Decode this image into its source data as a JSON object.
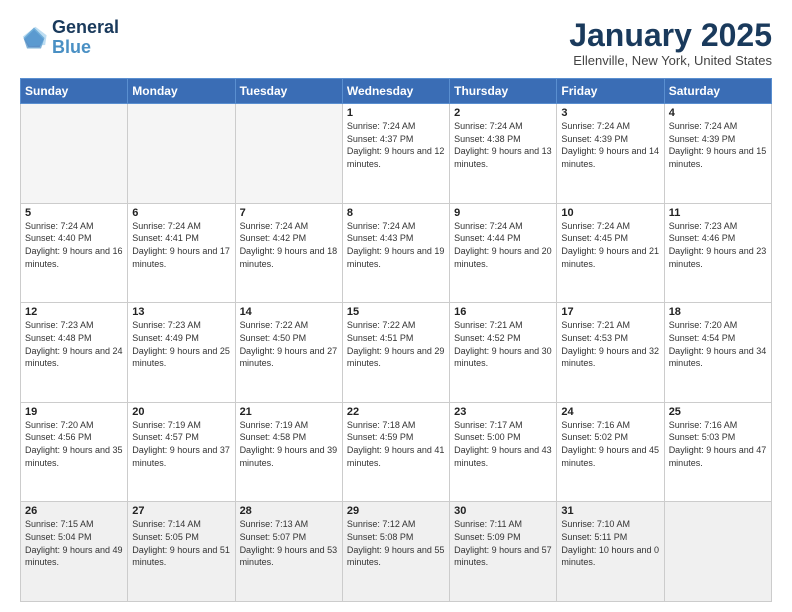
{
  "header": {
    "logo_line1": "General",
    "logo_line2": "Blue",
    "month": "January 2025",
    "location": "Ellenville, New York, United States"
  },
  "weekdays": [
    "Sunday",
    "Monday",
    "Tuesday",
    "Wednesday",
    "Thursday",
    "Friday",
    "Saturday"
  ],
  "weeks": [
    [
      {
        "day": "",
        "info": ""
      },
      {
        "day": "",
        "info": ""
      },
      {
        "day": "",
        "info": ""
      },
      {
        "day": "1",
        "info": "Sunrise: 7:24 AM\nSunset: 4:37 PM\nDaylight: 9 hours and 12 minutes."
      },
      {
        "day": "2",
        "info": "Sunrise: 7:24 AM\nSunset: 4:38 PM\nDaylight: 9 hours and 13 minutes."
      },
      {
        "day": "3",
        "info": "Sunrise: 7:24 AM\nSunset: 4:39 PM\nDaylight: 9 hours and 14 minutes."
      },
      {
        "day": "4",
        "info": "Sunrise: 7:24 AM\nSunset: 4:39 PM\nDaylight: 9 hours and 15 minutes."
      }
    ],
    [
      {
        "day": "5",
        "info": "Sunrise: 7:24 AM\nSunset: 4:40 PM\nDaylight: 9 hours and 16 minutes."
      },
      {
        "day": "6",
        "info": "Sunrise: 7:24 AM\nSunset: 4:41 PM\nDaylight: 9 hours and 17 minutes."
      },
      {
        "day": "7",
        "info": "Sunrise: 7:24 AM\nSunset: 4:42 PM\nDaylight: 9 hours and 18 minutes."
      },
      {
        "day": "8",
        "info": "Sunrise: 7:24 AM\nSunset: 4:43 PM\nDaylight: 9 hours and 19 minutes."
      },
      {
        "day": "9",
        "info": "Sunrise: 7:24 AM\nSunset: 4:44 PM\nDaylight: 9 hours and 20 minutes."
      },
      {
        "day": "10",
        "info": "Sunrise: 7:24 AM\nSunset: 4:45 PM\nDaylight: 9 hours and 21 minutes."
      },
      {
        "day": "11",
        "info": "Sunrise: 7:23 AM\nSunset: 4:46 PM\nDaylight: 9 hours and 23 minutes."
      }
    ],
    [
      {
        "day": "12",
        "info": "Sunrise: 7:23 AM\nSunset: 4:48 PM\nDaylight: 9 hours and 24 minutes."
      },
      {
        "day": "13",
        "info": "Sunrise: 7:23 AM\nSunset: 4:49 PM\nDaylight: 9 hours and 25 minutes."
      },
      {
        "day": "14",
        "info": "Sunrise: 7:22 AM\nSunset: 4:50 PM\nDaylight: 9 hours and 27 minutes."
      },
      {
        "day": "15",
        "info": "Sunrise: 7:22 AM\nSunset: 4:51 PM\nDaylight: 9 hours and 29 minutes."
      },
      {
        "day": "16",
        "info": "Sunrise: 7:21 AM\nSunset: 4:52 PM\nDaylight: 9 hours and 30 minutes."
      },
      {
        "day": "17",
        "info": "Sunrise: 7:21 AM\nSunset: 4:53 PM\nDaylight: 9 hours and 32 minutes."
      },
      {
        "day": "18",
        "info": "Sunrise: 7:20 AM\nSunset: 4:54 PM\nDaylight: 9 hours and 34 minutes."
      }
    ],
    [
      {
        "day": "19",
        "info": "Sunrise: 7:20 AM\nSunset: 4:56 PM\nDaylight: 9 hours and 35 minutes."
      },
      {
        "day": "20",
        "info": "Sunrise: 7:19 AM\nSunset: 4:57 PM\nDaylight: 9 hours and 37 minutes."
      },
      {
        "day": "21",
        "info": "Sunrise: 7:19 AM\nSunset: 4:58 PM\nDaylight: 9 hours and 39 minutes."
      },
      {
        "day": "22",
        "info": "Sunrise: 7:18 AM\nSunset: 4:59 PM\nDaylight: 9 hours and 41 minutes."
      },
      {
        "day": "23",
        "info": "Sunrise: 7:17 AM\nSunset: 5:00 PM\nDaylight: 9 hours and 43 minutes."
      },
      {
        "day": "24",
        "info": "Sunrise: 7:16 AM\nSunset: 5:02 PM\nDaylight: 9 hours and 45 minutes."
      },
      {
        "day": "25",
        "info": "Sunrise: 7:16 AM\nSunset: 5:03 PM\nDaylight: 9 hours and 47 minutes."
      }
    ],
    [
      {
        "day": "26",
        "info": "Sunrise: 7:15 AM\nSunset: 5:04 PM\nDaylight: 9 hours and 49 minutes."
      },
      {
        "day": "27",
        "info": "Sunrise: 7:14 AM\nSunset: 5:05 PM\nDaylight: 9 hours and 51 minutes."
      },
      {
        "day": "28",
        "info": "Sunrise: 7:13 AM\nSunset: 5:07 PM\nDaylight: 9 hours and 53 minutes."
      },
      {
        "day": "29",
        "info": "Sunrise: 7:12 AM\nSunset: 5:08 PM\nDaylight: 9 hours and 55 minutes."
      },
      {
        "day": "30",
        "info": "Sunrise: 7:11 AM\nSunset: 5:09 PM\nDaylight: 9 hours and 57 minutes."
      },
      {
        "day": "31",
        "info": "Sunrise: 7:10 AM\nSunset: 5:11 PM\nDaylight: 10 hours and 0 minutes."
      },
      {
        "day": "",
        "info": ""
      }
    ]
  ]
}
